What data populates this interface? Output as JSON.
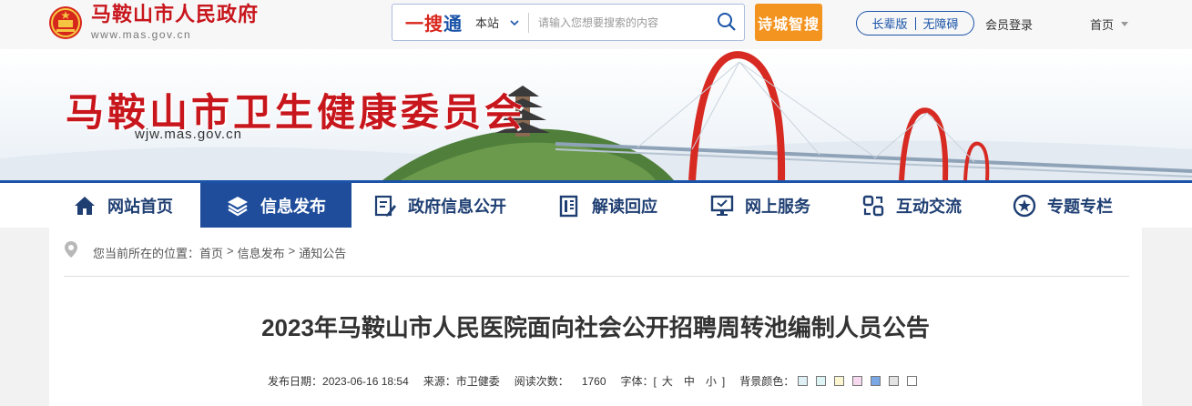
{
  "header": {
    "gov_name": "马鞍山市人民政府",
    "gov_url": "www.mas.gov.cn",
    "search": {
      "brand_part1": "一搜",
      "brand_part2": "通",
      "scope": "本站",
      "placeholder": "请输入您想要搜索的内容"
    },
    "poem_button": "诗城智搜",
    "elder_mode": "长辈版",
    "accessible": "无障碍",
    "member_login": "会员登录",
    "home": "首页"
  },
  "banner": {
    "title": "马鞍山市卫生健康委员会",
    "url": "wjw.mas.gov.cn"
  },
  "nav": {
    "items": [
      {
        "label": "网站首页",
        "icon": "home-icon"
      },
      {
        "label": "信息发布",
        "icon": "layers-icon"
      },
      {
        "label": "政府信息公开",
        "icon": "document-edit-icon"
      },
      {
        "label": "解读回应",
        "icon": "book-icon"
      },
      {
        "label": "网上服务",
        "icon": "monitor-icon"
      },
      {
        "label": "互动交流",
        "icon": "exchange-icon"
      },
      {
        "label": "专题专栏",
        "icon": "star-icon"
      }
    ],
    "active_index": 1
  },
  "breadcrumb": {
    "prefix": "您当前所在的位置：",
    "items": [
      "首页",
      "信息发布",
      "通知公告"
    ],
    "separator": ">"
  },
  "article": {
    "title": "2023年马鞍山市人民医院面向社会公开招聘周转池编制人员公告",
    "date_label": "发布日期：",
    "date": "2023-06-16 18:54",
    "source_label": "来源：",
    "source": "市卫健委",
    "views_label": "阅读次数：",
    "views": "1760",
    "font_label": "字体：",
    "font_open": "[",
    "font_large": "大",
    "font_medium": "中",
    "font_small": "小",
    "font_close": "]",
    "bg_label": "背景颜色：",
    "bg_colors": [
      "#dff1f6",
      "#ddf5f5",
      "#fbf6cf",
      "#f7d9ef",
      "#7aa8e4",
      "#e3e3e3",
      "#ffffff"
    ]
  }
}
